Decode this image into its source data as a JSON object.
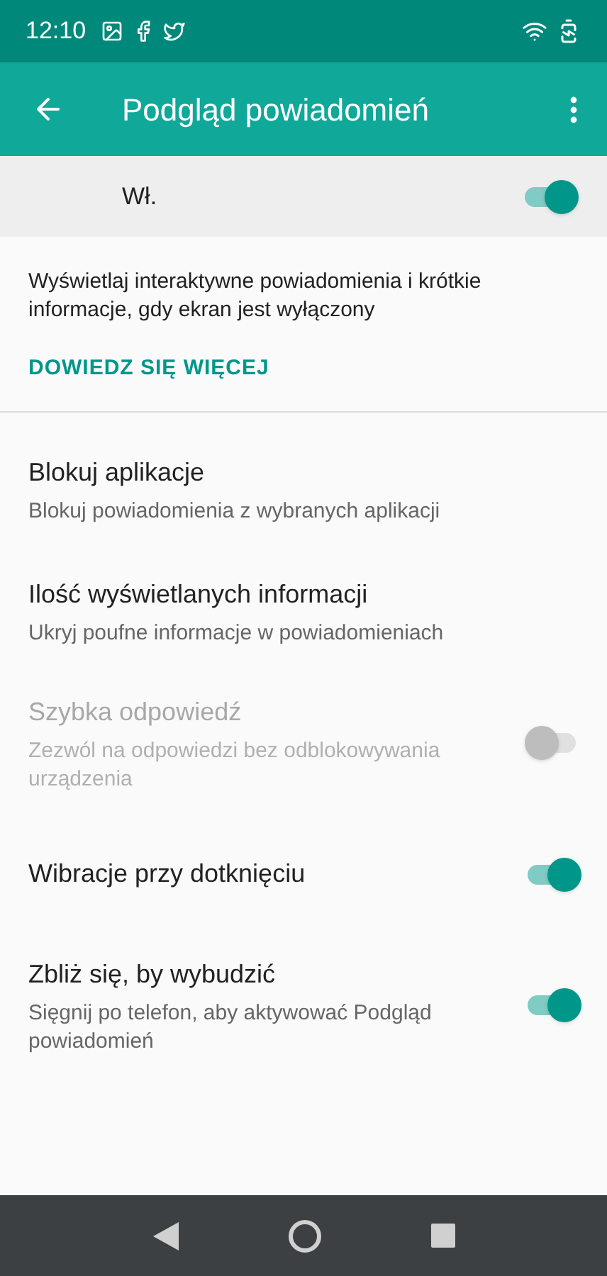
{
  "status_bar": {
    "time": "12:10"
  },
  "app_bar": {
    "title": "Podgląd powiadomień"
  },
  "master": {
    "label": "Wł.",
    "on": true
  },
  "description": "Wyświetlaj interaktywne powiadomienia i krótkie informacje, gdy ekran jest wyłączony",
  "learn_more": "DOWIEDZ SIĘ WIĘCEJ",
  "settings": [
    {
      "kind": "link",
      "title": "Blokuj aplikacje",
      "summary": "Blokuj powiadomienia z wybranych aplikacji",
      "disabled": false
    },
    {
      "kind": "link",
      "title": "Ilość wyświetlanych informacji",
      "summary": "Ukryj poufne informacje w powiadomieniach",
      "disabled": false
    },
    {
      "kind": "toggle",
      "title": "Szybka odpowiedź",
      "summary": "Zezwól na odpowiedzi bez odblokowywania urządzenia",
      "disabled": true,
      "on": false
    },
    {
      "kind": "toggle",
      "title": "Wibracje przy dotknięciu",
      "disabled": false,
      "on": true
    },
    {
      "kind": "toggle",
      "title": "Zbliż się, by wybudzić",
      "summary": "Sięgnij po telefon, aby aktywować Podgląd powiadomień",
      "disabled": false,
      "on": true
    }
  ]
}
